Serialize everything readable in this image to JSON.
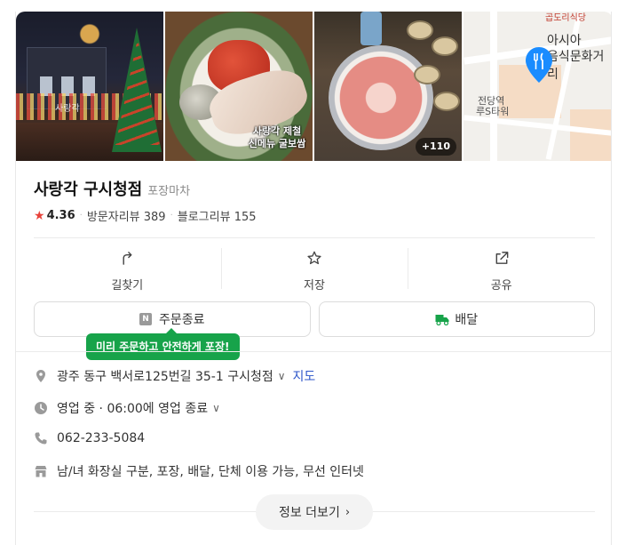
{
  "photos": {
    "p1_sign": "사랑각",
    "p2_caption": "사랑각 제철\n신메뉴 굴보쌈",
    "more_count": "+110",
    "map": {
      "label_top": "곱도리식당",
      "label_place1": "아시아",
      "label_place2": "음식문화거리",
      "label_station1": "전당역",
      "label_station2": "루S타워"
    }
  },
  "place": {
    "name": "사랑각 구시청점",
    "category": "포장마차",
    "rating": "4.36",
    "visitor_reviews": "방문자리뷰 389",
    "blog_reviews": "블로그리뷰 155"
  },
  "actions": [
    {
      "label": "길찾기",
      "icon": "directions-icon"
    },
    {
      "label": "저장",
      "icon": "star-outline-icon"
    },
    {
      "label": "공유",
      "icon": "share-icon"
    }
  ],
  "buttons": {
    "order": "주문종료",
    "order_badge": "N",
    "delivery": "배달"
  },
  "tooltip": "미리 주문하고 안전하게 포장!",
  "info": {
    "address": "광주 동구 백서로125번길 35-1 구시청점",
    "map_link": "지도",
    "hours": "영업 중 · 06:00에 영업 종료",
    "phone": "062-233-5084",
    "facilities": "남/녀 화장실 구분, 포장, 배달, 단체 이용 가능, 무선 인터넷"
  },
  "more_button": "정보 더보기",
  "colors": {
    "star": "#e8423a",
    "link": "#2c55c9",
    "tooltip": "#17a34a",
    "delivery_icon": "#17a34a",
    "map_pin": "#1a8cff"
  }
}
